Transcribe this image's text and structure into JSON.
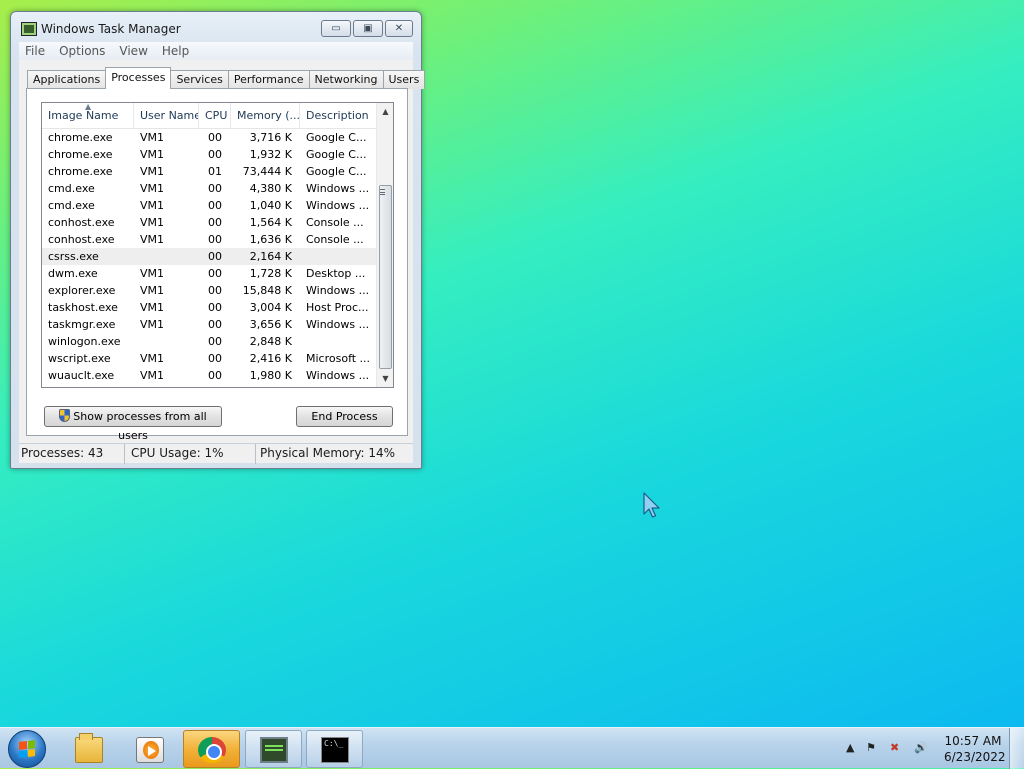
{
  "window": {
    "title": "Windows Task Manager",
    "minimize_label": "▭",
    "maximize_label": "▣",
    "close_label": "✕"
  },
  "menu": [
    "File",
    "Options",
    "View",
    "Help"
  ],
  "tabs": [
    "Applications",
    "Processes",
    "Services",
    "Performance",
    "Networking",
    "Users"
  ],
  "active_tab": "Processes",
  "columns": {
    "image_name": "Image Name",
    "user_name": "User Name",
    "cpu": "CPU",
    "memory": "Memory (...",
    "description": "Description"
  },
  "processes": [
    {
      "name": "chrome.exe",
      "user": "VM1",
      "cpu": "00",
      "memory": "3,716 K",
      "description": "Google C..."
    },
    {
      "name": "chrome.exe",
      "user": "VM1",
      "cpu": "00",
      "memory": "1,932 K",
      "description": "Google C..."
    },
    {
      "name": "chrome.exe",
      "user": "VM1",
      "cpu": "01",
      "memory": "73,444 K",
      "description": "Google C..."
    },
    {
      "name": "cmd.exe",
      "user": "VM1",
      "cpu": "00",
      "memory": "4,380 K",
      "description": "Windows ..."
    },
    {
      "name": "cmd.exe",
      "user": "VM1",
      "cpu": "00",
      "memory": "1,040 K",
      "description": "Windows ..."
    },
    {
      "name": "conhost.exe",
      "user": "VM1",
      "cpu": "00",
      "memory": "1,564 K",
      "description": "Console ..."
    },
    {
      "name": "conhost.exe",
      "user": "VM1",
      "cpu": "00",
      "memory": "1,636 K",
      "description": "Console ..."
    },
    {
      "name": "csrss.exe",
      "user": "",
      "cpu": "00",
      "memory": "2,164 K",
      "description": ""
    },
    {
      "name": "dwm.exe",
      "user": "VM1",
      "cpu": "00",
      "memory": "1,728 K",
      "description": "Desktop ..."
    },
    {
      "name": "explorer.exe",
      "user": "VM1",
      "cpu": "00",
      "memory": "15,848 K",
      "description": "Windows ..."
    },
    {
      "name": "taskhost.exe",
      "user": "VM1",
      "cpu": "00",
      "memory": "3,004 K",
      "description": "Host Proc..."
    },
    {
      "name": "taskmgr.exe",
      "user": "VM1",
      "cpu": "00",
      "memory": "3,656 K",
      "description": "Windows ..."
    },
    {
      "name": "winlogon.exe",
      "user": "",
      "cpu": "00",
      "memory": "2,848 K",
      "description": ""
    },
    {
      "name": "wscript.exe",
      "user": "VM1",
      "cpu": "00",
      "memory": "2,416 K",
      "description": "Microsoft ..."
    },
    {
      "name": "wuauclt.exe",
      "user": "VM1",
      "cpu": "00",
      "memory": "1,980 K",
      "description": "Windows ..."
    }
  ],
  "selected_row": 7,
  "buttons": {
    "show_all": "Show processes from all users",
    "end_process": "End Process"
  },
  "status": {
    "processes": "Processes: 43",
    "cpu": "CPU Usage: 1%",
    "memory": "Physical Memory: 14%"
  },
  "taskbar": {
    "pinned": [
      {
        "name": "explorer",
        "icon": "folder-icon",
        "state": "pinned"
      },
      {
        "name": "media-player",
        "icon": "media-player-icon",
        "state": "pinned"
      },
      {
        "name": "chrome",
        "icon": "chrome-icon",
        "state": "active"
      },
      {
        "name": "task-manager",
        "icon": "task-manager-icon",
        "state": "running"
      },
      {
        "name": "cmd",
        "icon": "cmd-icon",
        "state": "running"
      }
    ],
    "cmd_icon_text": "C:\\_",
    "clock_time": "10:57 AM",
    "clock_date": "6/23/2022"
  },
  "colors": {
    "active_taskbar_button": "#f2b23a",
    "selected_row": "#eeeeef"
  }
}
